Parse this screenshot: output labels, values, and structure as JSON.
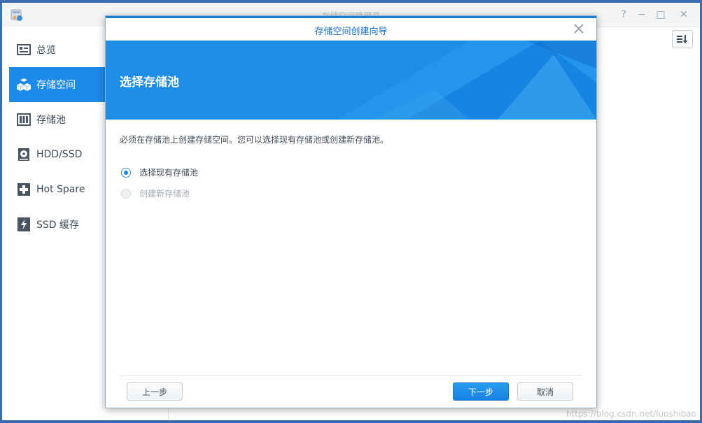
{
  "app": {
    "title": "存储空间管理员"
  },
  "window_controls": {
    "help": "?",
    "minimize": "−",
    "maximize": "□",
    "close": "✕"
  },
  "sidebar": {
    "items": [
      {
        "label": "总览",
        "icon": "overview-icon",
        "active": false
      },
      {
        "label": "存储空间",
        "icon": "volume-cubes-icon",
        "active": true
      },
      {
        "label": "存储池",
        "icon": "storage-pool-icon",
        "active": false
      },
      {
        "label": "HDD/SSD",
        "icon": "disk-icon",
        "active": false
      },
      {
        "label": "Hot Spare",
        "icon": "hot-spare-plus-icon",
        "active": false
      },
      {
        "label": "SSD 缓存",
        "icon": "ssd-cache-bolt-icon",
        "active": false
      }
    ]
  },
  "dialog": {
    "title": "存储空间创建向导",
    "heading": "选择存储池",
    "description": "必须在存储池上创建存储空间。您可以选择现有存储池或创建新存储池。",
    "options": [
      {
        "label": "选择现有存储池",
        "selected": true,
        "enabled": true
      },
      {
        "label": "创建新存储池",
        "selected": false,
        "enabled": false
      }
    ],
    "buttons": {
      "prev": "上一步",
      "next": "下一步",
      "cancel": "取消"
    }
  },
  "watermark": "https://blog.csdn.net/luoshibao",
  "colors": {
    "accent": "#1e8ae8",
    "banner": "#1d8de8",
    "title_blue": "#1b6fc7",
    "desktop": "#3c6fb0"
  }
}
